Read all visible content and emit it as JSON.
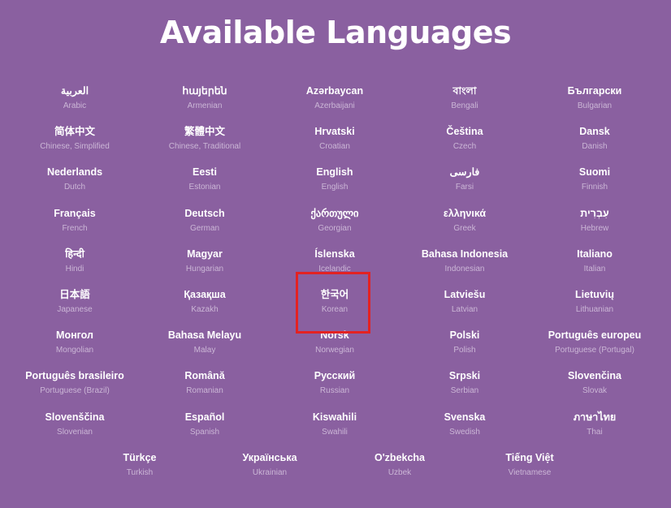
{
  "page": {
    "title": "Available Languages"
  },
  "languages": [
    {
      "native": "العربية",
      "english": "Arabic"
    },
    {
      "native": "հայերեն",
      "english": "Armenian"
    },
    {
      "native": "Azərbaycan",
      "english": "Azerbaijani"
    },
    {
      "native": "বাংলা",
      "english": "Bengali"
    },
    {
      "native": "Български",
      "english": "Bulgarian"
    },
    {
      "native": "简体中文",
      "english": "Chinese, Simplified"
    },
    {
      "native": "繁體中文",
      "english": "Chinese, Traditional"
    },
    {
      "native": "Hrvatski",
      "english": "Croatian"
    },
    {
      "native": "Čeština",
      "english": "Czech"
    },
    {
      "native": "Dansk",
      "english": "Danish"
    },
    {
      "native": "Nederlands",
      "english": "Dutch"
    },
    {
      "native": "Eesti",
      "english": "Estonian"
    },
    {
      "native": "English",
      "english": "English"
    },
    {
      "native": "فارسی",
      "english": "Farsi"
    },
    {
      "native": "Suomi",
      "english": "Finnish"
    },
    {
      "native": "Français",
      "english": "French"
    },
    {
      "native": "Deutsch",
      "english": "German"
    },
    {
      "native": "ქართული",
      "english": "Georgian"
    },
    {
      "native": "ελληνικά",
      "english": "Greek"
    },
    {
      "native": "עִבְרִית",
      "english": "Hebrew"
    },
    {
      "native": "हिन्दी",
      "english": "Hindi"
    },
    {
      "native": "Magyar",
      "english": "Hungarian"
    },
    {
      "native": "Íslenska",
      "english": "Icelandic"
    },
    {
      "native": "Bahasa Indonesia",
      "english": "Indonesian"
    },
    {
      "native": "Italiano",
      "english": "Italian"
    },
    {
      "native": "日本語",
      "english": "Japanese"
    },
    {
      "native": "Қазақша",
      "english": "Kazakh"
    },
    {
      "native": "한국어",
      "english": "Korean"
    },
    {
      "native": "Latviešu",
      "english": "Latvian"
    },
    {
      "native": "Lietuvių",
      "english": "Lithuanian"
    },
    {
      "native": "Монгол",
      "english": "Mongolian"
    },
    {
      "native": "Bahasa Melayu",
      "english": "Malay"
    },
    {
      "native": "Norsk",
      "english": "Norwegian"
    },
    {
      "native": "Polski",
      "english": "Polish"
    },
    {
      "native": "Português europeu",
      "english": "Portuguese (Portugal)"
    },
    {
      "native": "Português brasileiro",
      "english": "Portuguese (Brazil)"
    },
    {
      "native": "Română",
      "english": "Romanian"
    },
    {
      "native": "Русский",
      "english": "Russian"
    },
    {
      "native": "Srpski",
      "english": "Serbian"
    },
    {
      "native": "Slovenčina",
      "english": "Slovak"
    },
    {
      "native": "Slovenščina",
      "english": "Slovenian"
    },
    {
      "native": "Español",
      "english": "Spanish"
    },
    {
      "native": "Kiswahili",
      "english": "Swahili"
    },
    {
      "native": "Svenska",
      "english": "Swedish"
    },
    {
      "native": "ภาษาไทย",
      "english": "Thai"
    }
  ],
  "last_row": [
    {
      "native": "Türkçe",
      "english": "Turkish"
    },
    {
      "native": "Українська",
      "english": "Ukrainian"
    },
    {
      "native": "O'zbekcha",
      "english": "Uzbek"
    },
    {
      "native": "Tiếng Việt",
      "english": "Vietnamese"
    }
  ],
  "colors": {
    "background": "#8a60a0",
    "text_primary": "#ffffff",
    "text_secondary": "#cbb6d6",
    "highlight": "#e32222"
  }
}
